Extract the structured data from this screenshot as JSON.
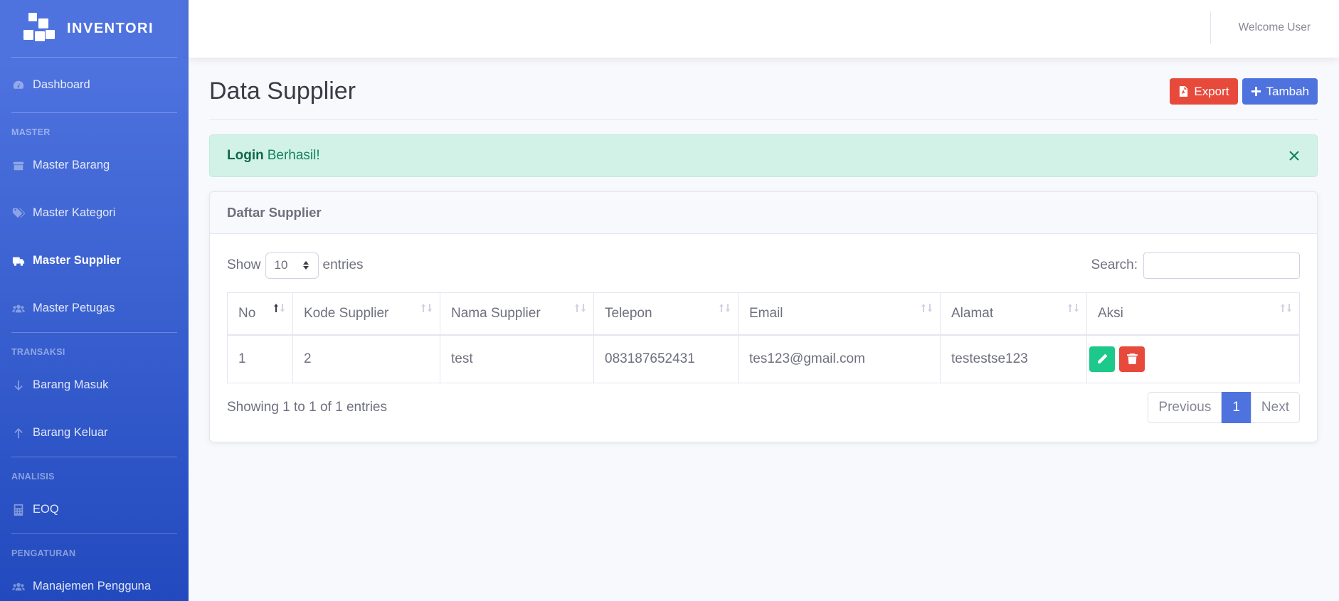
{
  "brand": {
    "name": "INVENTORI"
  },
  "topbar": {
    "welcome": "Welcome User"
  },
  "sidebar": {
    "dashboard": "Dashboard",
    "headings": {
      "master": "MASTER",
      "transaksi": "TRANSAKSI",
      "analisis": "ANALISIS",
      "pengaturan": "PENGATURAN"
    },
    "items": {
      "master_barang": "Master Barang",
      "master_kategori": "Master Kategori",
      "master_supplier": "Master Supplier",
      "master_petugas": "Master Petugas",
      "barang_masuk": "Barang Masuk",
      "barang_keluar": "Barang Keluar",
      "eoq": "EOQ",
      "manajemen_pengguna": "Manajemen Pengguna"
    },
    "active": "master_supplier"
  },
  "page": {
    "title": "Data Supplier",
    "export_label": "Export",
    "add_label": "Tambah"
  },
  "alert": {
    "strong": "Login",
    "text": "Berhasil!"
  },
  "card": {
    "title": "Daftar Supplier"
  },
  "datatable": {
    "show_label": "Show",
    "entries_label": "entries",
    "page_length": "10",
    "search_label": "Search:",
    "search_value": "",
    "columns": [
      "No",
      "Kode Supplier",
      "Nama Supplier",
      "Telepon",
      "Email",
      "Alamat",
      "Aksi"
    ],
    "rows": [
      {
        "no": "1",
        "kode": "2",
        "nama": "test",
        "telepon": "083187652431",
        "email": "tes123@gmail.com",
        "alamat": "testestse123"
      }
    ],
    "info": "Showing 1 to 1 of 1 entries",
    "pagination": {
      "previous": "Previous",
      "current": "1",
      "next": "Next"
    }
  },
  "colors": {
    "sidebar_top": "#4e73df",
    "sidebar_bottom": "#224abe",
    "export": "#e74a3b",
    "add": "#4e73df",
    "success": "#1cc88a",
    "danger": "#e74a3b",
    "alert_bg": "#d3f2e7"
  },
  "icons": {
    "dashboard": "tachometer-icon",
    "master_barang": "box-icon",
    "master_kategori": "tags-icon",
    "master_supplier": "truck-icon",
    "master_petugas": "users-icon",
    "barang_masuk": "arrow-down-icon",
    "barang_keluar": "arrow-up-icon",
    "eoq": "calculator-icon",
    "manajemen_pengguna": "users-icon",
    "export": "file-pdf-icon",
    "add": "plus-icon",
    "edit": "pencil-icon",
    "delete": "trash-icon",
    "close": "close-icon"
  }
}
